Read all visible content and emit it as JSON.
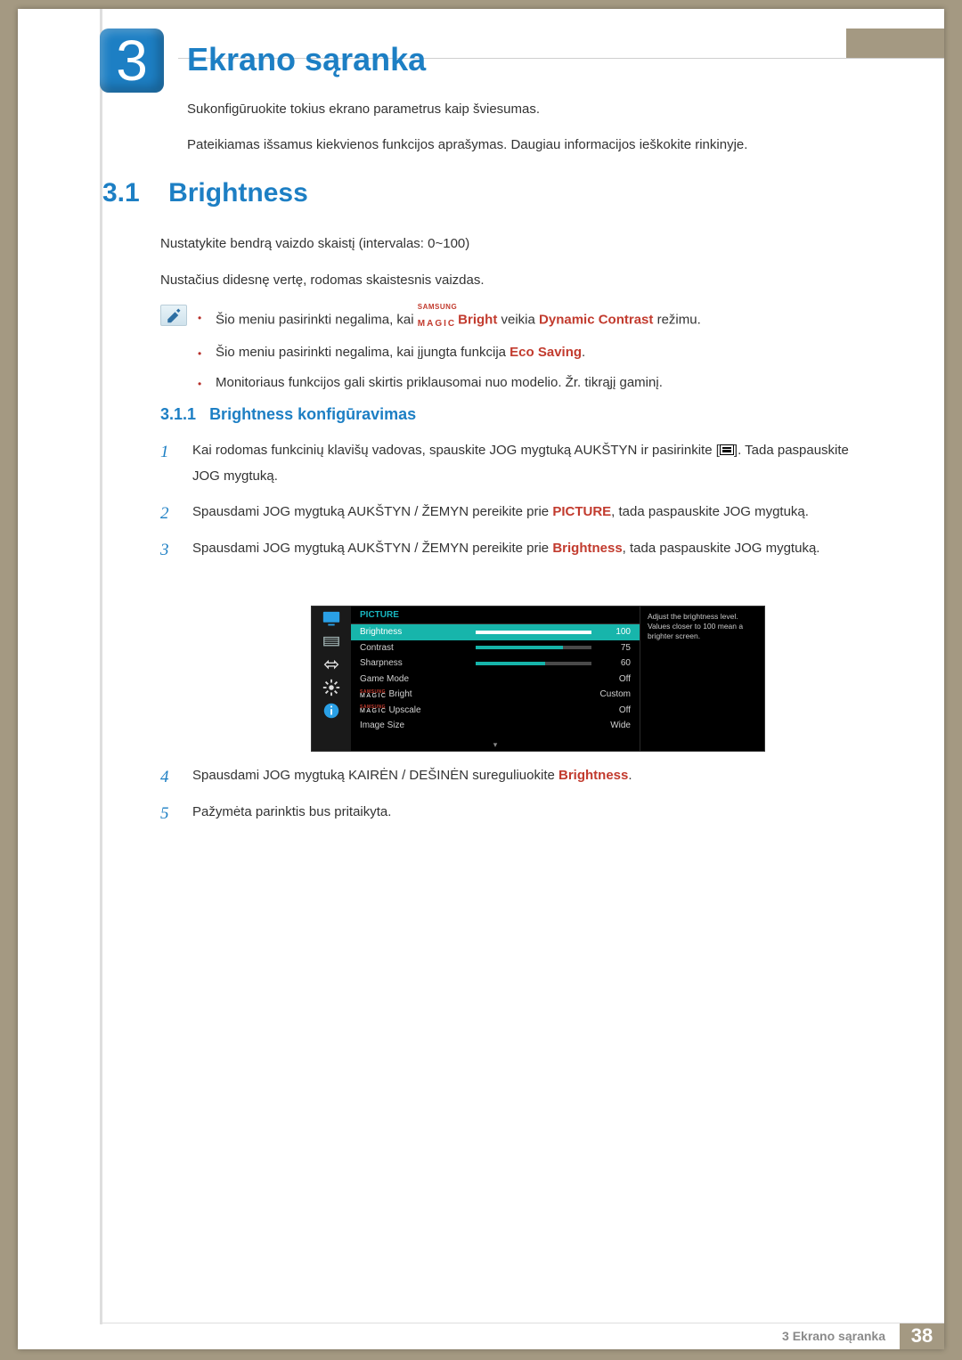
{
  "chapter_badge": "3",
  "chapter_title": "Ekrano sąranka",
  "intro": {
    "p1": "Sukonfigūruokite tokius ekrano parametrus kaip šviesumas.",
    "p2": "Pateikiamas išsamus kiekvienos funkcijos aprašymas. Daugiau informacijos ieškokite rinkinyje."
  },
  "section": {
    "num": "3.1",
    "title": "Brightness",
    "p1": "Nustatykite bendrą vaizdo skaistį (intervalas: 0~100)",
    "p2": "Nustačius didesnę vertę, rodomas skaistesnis vaizdas."
  },
  "notes": {
    "n1_a": "Šio meniu pasirinkti negalima, kai ",
    "n1_magic_top": "SAMSUNG",
    "n1_magic_bot": "MAGIC",
    "n1_b": "Bright",
    "n1_c": " veikia ",
    "n1_d": "Dynamic Contrast",
    "n1_e": " režimu.",
    "n2_a": "Šio meniu pasirinkti negalima, kai įjungta funkcija ",
    "n2_b": "Eco Saving",
    "n2_c": ".",
    "n3": "Monitoriaus funkcijos gali skirtis priklausomai nuo modelio. Žr. tikrąjį gaminį."
  },
  "subsection": {
    "num": "3.1.1",
    "title": "Brightness konfigūravimas"
  },
  "steps": {
    "s1a": "Kai rodomas funkcinių klavišų vadovas, spauskite JOG mygtuką AUKŠTYN ir pasirinkite [",
    "s1b": "]. Tada paspauskite JOG mygtuką.",
    "s2a": "Spausdami JOG mygtuką AUKŠTYN / ŽEMYN pereikite prie ",
    "s2b": "PICTURE",
    "s2c": ", tada paspauskite JOG mygtuką.",
    "s3a": "Spausdami JOG mygtuką AUKŠTYN / ŽEMYN pereikite prie ",
    "s3b": "Brightness",
    "s3c": ", tada paspauskite JOG mygtuką.",
    "s4a": "Spausdami JOG mygtuką KAIRĖN / DEŠINĖN sureguliuokite ",
    "s4b": "Brightness",
    "s4c": ".",
    "s5": "Pažymėta parinktis bus pritaikyta."
  },
  "osd": {
    "header": "PICTURE",
    "help": "Adjust the brightness level. Values closer to 100 mean a brighter screen.",
    "rows": [
      {
        "label": "Brightness",
        "value": "100",
        "bar": 100,
        "selected": true
      },
      {
        "label": "Contrast",
        "value": "75",
        "bar": 75,
        "selected": false
      },
      {
        "label": "Sharpness",
        "value": "60",
        "bar": 60,
        "selected": false
      },
      {
        "label": "Game Mode",
        "value": "Off",
        "selected": false
      },
      {
        "label": "Bright",
        "value": "Custom",
        "magic": true,
        "selected": false
      },
      {
        "label": "Upscale",
        "value": "Off",
        "magic": true,
        "selected": false
      },
      {
        "label": "Image Size",
        "value": "Wide",
        "selected": false
      }
    ]
  },
  "footer": {
    "crumb_num": "3",
    "crumb_title": "Ekrano sąranka",
    "page": "38"
  }
}
